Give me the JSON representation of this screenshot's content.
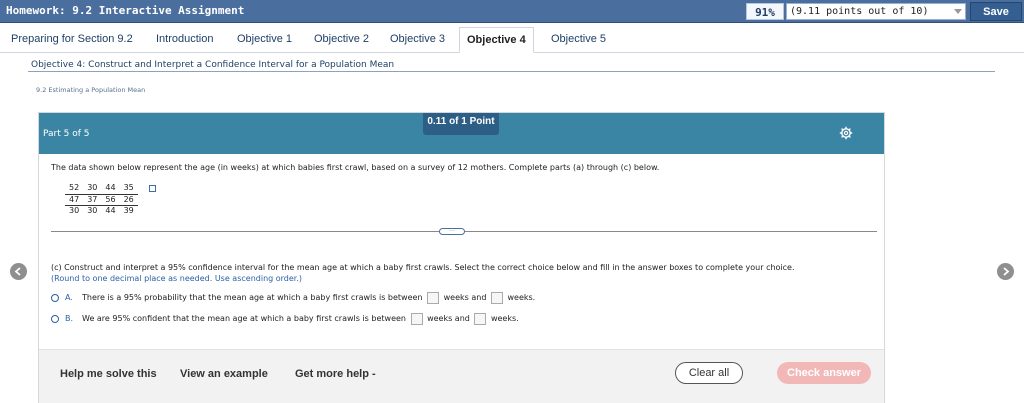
{
  "header": {
    "title": "Homework: 9.2 Interactive Assignment",
    "score_percent": "91%",
    "score_detail": "(9.11 points out of 10)",
    "save_label": "Save"
  },
  "tabs": [
    {
      "label": "Preparing for Section 9.2"
    },
    {
      "label": "Introduction"
    },
    {
      "label": "Objective 1"
    },
    {
      "label": "Objective 2"
    },
    {
      "label": "Objective 3"
    },
    {
      "label": "Objective 4",
      "active": true
    },
    {
      "label": "Objective 5"
    }
  ],
  "objective_title": "Objective 4: Construct and Interpret a Confidence Interval for a Population Mean",
  "section_title": "9.2 Estimating a Population Mean",
  "panel": {
    "part_label": "Part 5 of 5",
    "points_badge": "0.11 of 1 Point",
    "problem_text": "The data shown below represent the age (in weeks) at which babies first crawl, based on a survey of 12 mothers. Complete parts (a) through (c) below.",
    "data_rows": [
      [
        "52",
        "30",
        "44",
        "35"
      ],
      [
        "47",
        "37",
        "56",
        "26"
      ],
      [
        "30",
        "30",
        "44",
        "39"
      ]
    ],
    "question_line1": "(c) Construct and interpret a 95% confidence interval for the mean age at which a baby first crawls. Select the correct choice below and fill in the answer boxes to complete your choice.",
    "question_hint": "(Round to one decimal place as needed. Use ascending order.)",
    "choices": [
      {
        "letter": "A.",
        "pre": "There is a 95% probability that the mean age at which a baby first crawls is between",
        "mid": "weeks and",
        "post": "weeks."
      },
      {
        "letter": "B.",
        "pre": "We are 95% confident that the mean age at which a baby first crawls is between",
        "mid": "weeks and",
        "post": "weeks."
      }
    ]
  },
  "footer": {
    "help_solve": "Help me solve this",
    "view_example": "View an example",
    "more_help": "Get more help -",
    "clear_all": "Clear all",
    "check_answer": "Check answer"
  },
  "colors": {
    "topbar": "#4a6f9f",
    "panel_header": "#3b85a4",
    "check_button": "#f2b8b8"
  }
}
